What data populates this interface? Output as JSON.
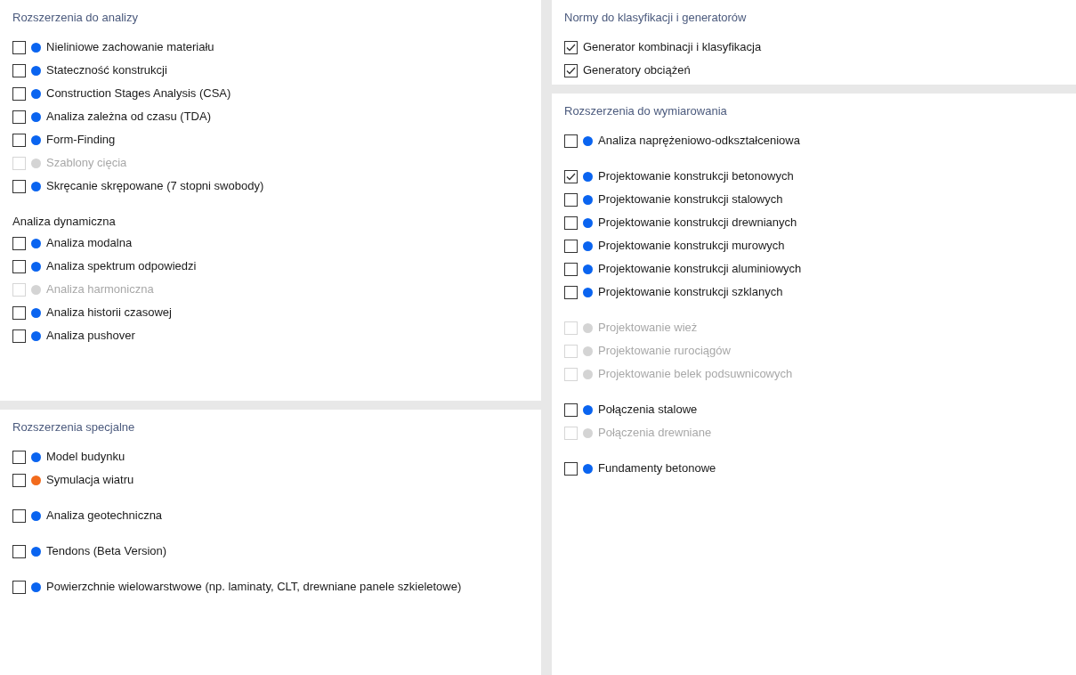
{
  "left_panel": {
    "sections": [
      {
        "title": "Rozszerzenia do analizy",
        "groups": [
          {
            "items": [
              {
                "label": "Nieliniowe zachowanie materiału",
                "checked": false,
                "disabled": false,
                "color": "#0a64f0"
              },
              {
                "label": "Stateczność konstrukcji",
                "checked": false,
                "disabled": false,
                "color": "#0a64f0"
              },
              {
                "label": "Construction Stages Analysis (CSA)",
                "checked": false,
                "disabled": false,
                "color": "#0a64f0"
              },
              {
                "label": "Analiza zależna od czasu (TDA)",
                "checked": false,
                "disabled": false,
                "color": "#0a64f0"
              },
              {
                "label": "Form-Finding",
                "checked": false,
                "disabled": false,
                "color": "#0a64f0"
              },
              {
                "label": "Szablony cięcia",
                "checked": false,
                "disabled": true,
                "color": "#d4d4d4"
              },
              {
                "label": "Skręcanie skrępowane (7 stopni swobody)",
                "checked": false,
                "disabled": false,
                "color": "#0a64f0"
              }
            ]
          },
          {
            "subtitle": "Analiza dynamiczna",
            "items": [
              {
                "label": "Analiza modalna",
                "checked": false,
                "disabled": false,
                "color": "#0a64f0"
              },
              {
                "label": "Analiza spektrum odpowiedzi",
                "checked": false,
                "disabled": false,
                "color": "#0a64f0"
              },
              {
                "label": "Analiza harmoniczna",
                "checked": false,
                "disabled": true,
                "color": "#d4d4d4"
              },
              {
                "label": "Analiza historii czasowej",
                "checked": false,
                "disabled": false,
                "color": "#0a64f0"
              },
              {
                "label": "Analiza pushover",
                "checked": false,
                "disabled": false,
                "color": "#0a64f0"
              }
            ]
          }
        ]
      },
      {
        "title": "Rozszerzenia specjalne",
        "groups": [
          {
            "items": [
              {
                "label": "Model budynku",
                "checked": false,
                "disabled": false,
                "color": "#0a64f0"
              },
              {
                "label": "Symulacja wiatru",
                "checked": false,
                "disabled": false,
                "color": "#f26b1d"
              }
            ]
          },
          {
            "items": [
              {
                "label": "Analiza geotechniczna",
                "checked": false,
                "disabled": false,
                "color": "#0a64f0"
              }
            ]
          },
          {
            "items": [
              {
                "label": "Tendons (Beta Version)",
                "checked": false,
                "disabled": false,
                "color": "#0a64f0"
              }
            ]
          },
          {
            "items": [
              {
                "label": "Powierzchnie wielowarstwowe (np. laminaty, CLT, drewniane panele szkieletowe)",
                "checked": false,
                "disabled": false,
                "color": "#0a64f0"
              }
            ]
          }
        ]
      }
    ]
  },
  "right_panel": {
    "sections": [
      {
        "title": "Normy do klasyfikacji i generatorów",
        "groups": [
          {
            "items": [
              {
                "label": "Generator kombinacji i klasyfikacja",
                "checked": true,
                "disabled": false
              },
              {
                "label": "Generatory obciążeń",
                "checked": true,
                "disabled": false
              }
            ]
          }
        ]
      },
      {
        "title": "Rozszerzenia do wymiarowania",
        "groups": [
          {
            "items": [
              {
                "label": "Analiza naprężeniowo-odkształceniowa",
                "checked": false,
                "disabled": false,
                "color": "#0a64f0"
              }
            ]
          },
          {
            "items": [
              {
                "label": "Projektowanie konstrukcji betonowych",
                "checked": true,
                "disabled": false,
                "color": "#0a64f0"
              },
              {
                "label": "Projektowanie konstrukcji stalowych",
                "checked": false,
                "disabled": false,
                "color": "#0a64f0"
              },
              {
                "label": "Projektowanie konstrukcji drewnianych",
                "checked": false,
                "disabled": false,
                "color": "#0a64f0"
              },
              {
                "label": "Projektowanie konstrukcji murowych",
                "checked": false,
                "disabled": false,
                "color": "#0a64f0"
              },
              {
                "label": "Projektowanie konstrukcji aluminiowych",
                "checked": false,
                "disabled": false,
                "color": "#0a64f0"
              },
              {
                "label": "Projektowanie konstrukcji szklanych",
                "checked": false,
                "disabled": false,
                "color": "#0a64f0"
              }
            ]
          },
          {
            "items": [
              {
                "label": "Projektowanie wież",
                "checked": false,
                "disabled": true,
                "color": "#d4d4d4"
              },
              {
                "label": "Projektowanie rurociągów",
                "checked": false,
                "disabled": true,
                "color": "#d4d4d4"
              },
              {
                "label": "Projektowanie belek podsuwnicowych",
                "checked": false,
                "disabled": true,
                "color": "#d4d4d4"
              }
            ]
          },
          {
            "items": [
              {
                "label": "Połączenia stalowe",
                "checked": false,
                "disabled": false,
                "color": "#0a64f0"
              },
              {
                "label": "Połączenia drewniane",
                "checked": false,
                "disabled": true,
                "color": "#d4d4d4"
              }
            ]
          },
          {
            "items": [
              {
                "label": "Fundamenty betonowe",
                "checked": false,
                "disabled": false,
                "color": "#0a64f0"
              }
            ]
          }
        ]
      }
    ]
  }
}
